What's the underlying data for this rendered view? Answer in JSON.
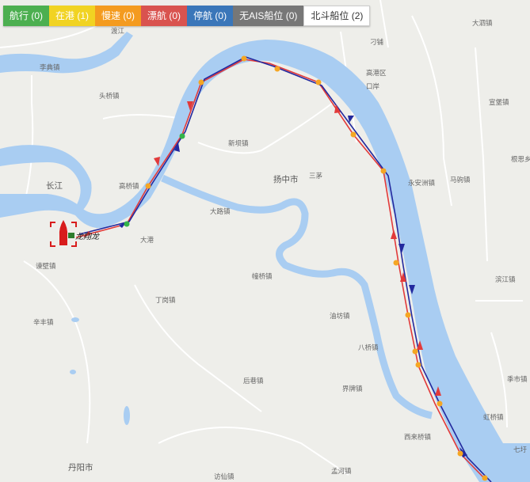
{
  "filters": [
    {
      "label": "航行 (0)",
      "color": "#4caf50"
    },
    {
      "label": "在港 (1)",
      "color": "#f1d322"
    },
    {
      "label": "慢速 (0)",
      "color": "#f49b1f"
    },
    {
      "label": "漂航 (0)",
      "color": "#d9534f"
    },
    {
      "label": "停航 (0)",
      "color": "#3a76b9"
    },
    {
      "label": "无AIS船位 (0)",
      "color": "#777777"
    },
    {
      "label": "北斗船位 (2)",
      "color": "#ffffff"
    }
  ],
  "map": {
    "water_color": "#a9cdf2",
    "land_color": "#eeeeea",
    "labels": {
      "river": "长江",
      "yangzhong": "扬中市",
      "danyang": "丹阳市",
      "lidian": "李典镇",
      "toujiao": "头桥镇",
      "gaoqiao": "高桥镇",
      "daju": "大路镇",
      "xinba": "新坝镇",
      "sanmao": "三茅",
      "dagang": "大港",
      "jianbi": "谏壁镇",
      "dingang": "丁岗镇",
      "xinfeng": "辛丰镇",
      "zhuangfu": "幢桥镇",
      "youfang": "油坊镇",
      "baqiao": "八桥镇",
      "houxiang": "后巷镇",
      "jieling": "界牌镇",
      "xilai": "西来桥镇",
      "yonganzhou": "永安洲镇",
      "majiao": "马驹镇",
      "gaogang": "高港区",
      "kouan": "口岸",
      "diaopu": "刁铺",
      "dayang": "大泗镇",
      "xuanbao": "宣堡镇",
      "genshu": "根思乡",
      "binjiang": "滨江镇",
      "hongqiao": "虹桥镇",
      "jiaji": "季市镇",
      "qiwei": "七圩",
      "menghe": "孟河镇",
      "shaqiao": "访仙镇",
      "ferry": "渡江"
    },
    "vessel": {
      "name": "龙翔龙",
      "color": "#d81c1c"
    },
    "track": {
      "outbound_color": "#e23a3a",
      "return_color": "#23299e",
      "waypoint_color": "#f5a623",
      "start_color": "#33b34a"
    }
  }
}
